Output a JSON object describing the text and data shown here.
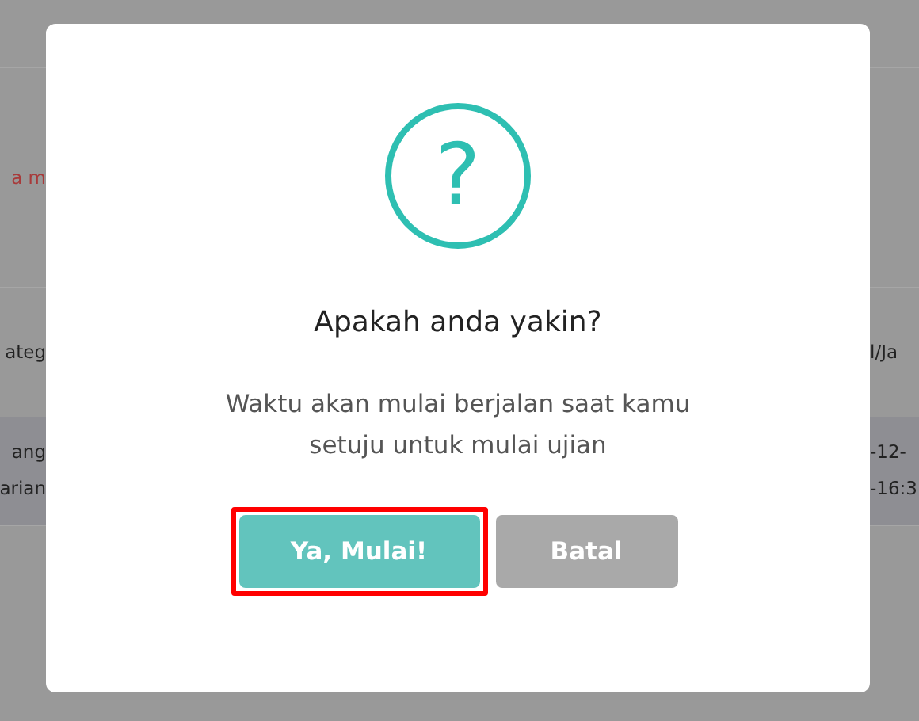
{
  "background": {
    "notice": {
      "left": "a m"
    },
    "table_header": {
      "left": "ateg",
      "right": "l/Ja"
    },
    "table_row": {
      "left_lines": [
        "ang",
        "arian"
      ],
      "right_lines": [
        "-12-",
        "-16:3"
      ]
    }
  },
  "dialog": {
    "icon": "?",
    "title": "Apakah anda yakin?",
    "message": "Waktu akan mulai berjalan saat kamu setuju untuk mulai ujian",
    "buttons": [
      {
        "label": "Ya, Mulai!",
        "kind": "confirm",
        "highlighted": true
      },
      {
        "label": "Batal",
        "kind": "cancel",
        "highlighted": false
      }
    ]
  }
}
